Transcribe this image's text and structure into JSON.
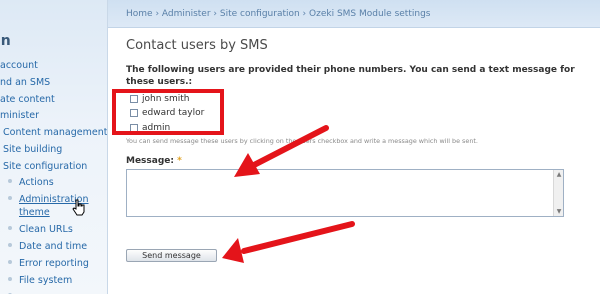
{
  "sidebar": {
    "heading": "in",
    "items": [
      {
        "label": "account"
      },
      {
        "label": "nd an SMS"
      },
      {
        "label": "ate content"
      },
      {
        "label": "minister"
      },
      {
        "label": "Content management"
      },
      {
        "label": "Site building"
      },
      {
        "label": "Site configuration"
      },
      {
        "label": "Actions"
      },
      {
        "label": "Administration"
      },
      {
        "label": "theme"
      },
      {
        "label": "Clean URLs"
      },
      {
        "label": "Date and time"
      },
      {
        "label": "Error reporting"
      },
      {
        "label": "File system"
      }
    ]
  },
  "breadcrumb": "Home › Administer › Site configuration › Ozeki SMS Module settings",
  "main": {
    "title": "Contact users by SMS",
    "intro": "The following users are provided their phone numbers. You can send a text message for these users.:",
    "users": [
      {
        "name": "john smith",
        "checked": false
      },
      {
        "name": "edward taylor",
        "checked": false
      },
      {
        "name": "admin",
        "checked": false
      }
    ],
    "help": "You can send message these users by clicking on the users checkbox and write a message which will be sent.",
    "message_label": "Message:",
    "required_marker": "*",
    "message_value": "",
    "send_label": "Send message"
  },
  "colors": {
    "annotation_red": "#e4141a",
    "link_blue": "#2769a8",
    "sidebar_bg": "#e8f0f8"
  },
  "icons": {
    "cursor": "hand-pointer-icon",
    "arrows": "red-arrow-icon"
  }
}
